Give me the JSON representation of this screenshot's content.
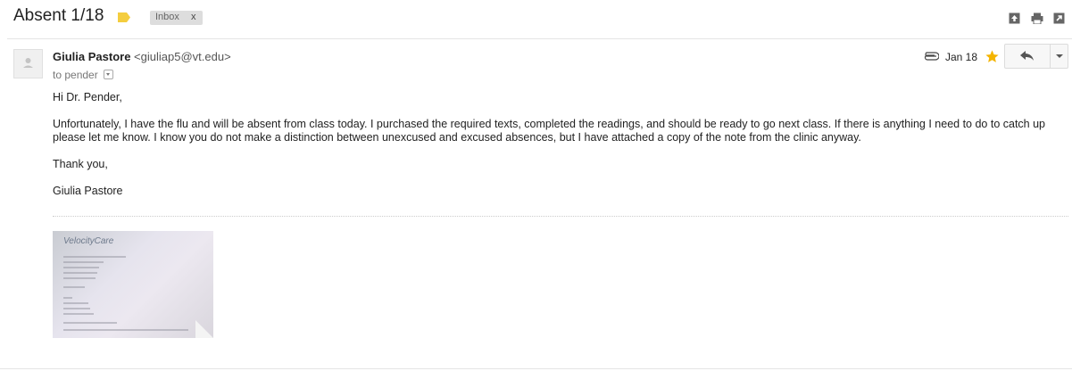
{
  "header": {
    "subject": "Absent 1/18",
    "label_color": "#f4cd3f",
    "inbox_label": "Inbox",
    "inbox_remove": "x",
    "icons": [
      "archive-icon",
      "print-icon",
      "new-window-icon"
    ]
  },
  "message": {
    "sender_name": "Giulia Pastore",
    "sender_email": "<giuliap5@vt.edu>",
    "to_line": "to pender",
    "date": "Jan 18",
    "starred": true,
    "star_color": "#f4b400",
    "greeting": "Hi Dr. Pender,",
    "paragraph": "Unfortunately, I have the flu and will be absent from class today. I purchased the required texts, completed the readings, and should be ready to go next class. If there is anything I need to do to catch up please let me know. I know you do not make a distinction between unexcused and excused absences, but I have attached a copy of the note from the clinic anyway.",
    "closing": "Thank you,",
    "signature": "Giulia Pastore"
  },
  "attachment": {
    "logo_text": "VelocityCare"
  }
}
